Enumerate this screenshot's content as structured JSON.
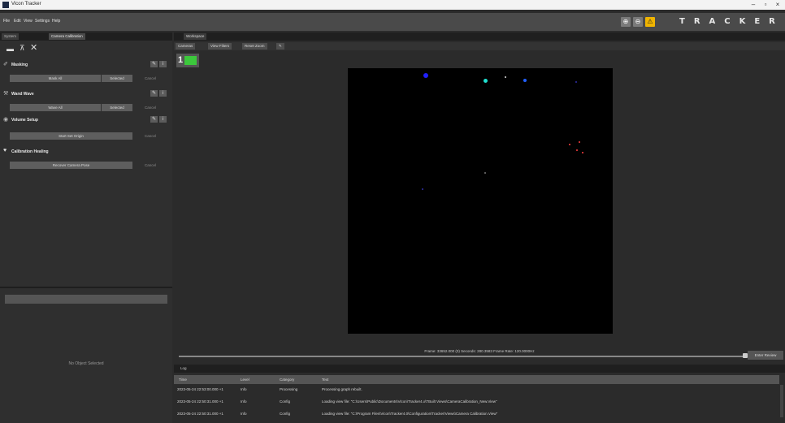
{
  "window": {
    "title": "Vicon Tracker"
  },
  "menu": [
    "File",
    "Edit",
    "View",
    "Settings",
    "Help"
  ],
  "brand": "TRACKER",
  "left_tabs": [
    "System",
    "Camera Calibration"
  ],
  "sections": {
    "masking": {
      "title": "Masking",
      "btn_main": "Mask All",
      "btn_sel": "Selected",
      "btn_cancel": "Cancel"
    },
    "wand": {
      "title": "Wand Wave",
      "btn_main": "Wave All",
      "btn_sel": "Selected",
      "btn_cancel": "Cancel"
    },
    "volume": {
      "title": "Volume Setup",
      "btn_main": "Start Set Origin",
      "btn_cancel": "Cancel"
    },
    "healing": {
      "title": "Calibration Healing",
      "btn_main": "Recover Camera Pose",
      "btn_cancel": "Cancel"
    }
  },
  "no_object": "No Object Selected",
  "workspace": {
    "tab": "Workspace",
    "toolbar": [
      "Cameras",
      "View Filters",
      "Reset Zoom"
    ],
    "camera_id": "1",
    "status": "Frame: 33652.000 (0)   Seconds: 280.3583   Frame Rate: 120.0000Hz",
    "enable_review": "Enter Review"
  },
  "log": {
    "title": "Log",
    "columns": [
      "Time",
      "Level",
      "Category",
      "Text"
    ],
    "rows": [
      {
        "time": "2023-05-24 22:53:00.000 +1",
        "level": "Info",
        "category": "Processing",
        "text": "Processing graph rebuilt."
      },
      {
        "time": "2023-05-24 22:50:31.000 +1",
        "level": "Info",
        "category": "Config",
        "text": "Loading view file: \"C:\\Users\\Public\\Documents\\Vicon\\Tracker4.x\\TBuilt Views\\CameraCalibration_New.View\""
      },
      {
        "time": "2023-05-24 22:50:31.000 +1",
        "level": "Info",
        "category": "Config",
        "text": "Loading view file: \"C:\\Program Files\\Vicon\\Tracker4.0\\Configuration\\Tracker\\Views\\Camera Calibration.View\""
      }
    ]
  },
  "colors": {
    "accent": "#3cc83c",
    "warn": "#f0b400"
  }
}
